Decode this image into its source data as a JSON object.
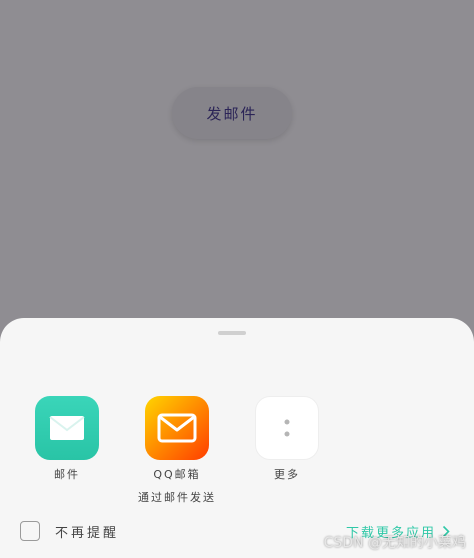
{
  "main": {
    "send_button_label": "发邮件"
  },
  "share_sheet": {
    "apps": [
      {
        "label": "邮件",
        "icon": "envelope-icon"
      },
      {
        "label": "QQ邮箱",
        "sublabel": "通过邮件发送",
        "icon": "qq-mail-envelope-icon"
      },
      {
        "label": "更多",
        "icon": "more-dots-icon"
      }
    ],
    "dont_remind_label": "不再提醒",
    "download_more_label": "下载更多应用",
    "chevron_icon": "chevron-right-icon"
  },
  "watermark": "CSDN @无知的小菜鸡",
  "colors": {
    "overlay": "#8f8d92",
    "sheet_background": "#f6f6f6",
    "accent": "#2fc8a7",
    "mail_app": "#2ecdb0",
    "qq_mail_gradient": [
      "#ffd500",
      "#ff3d00"
    ]
  }
}
